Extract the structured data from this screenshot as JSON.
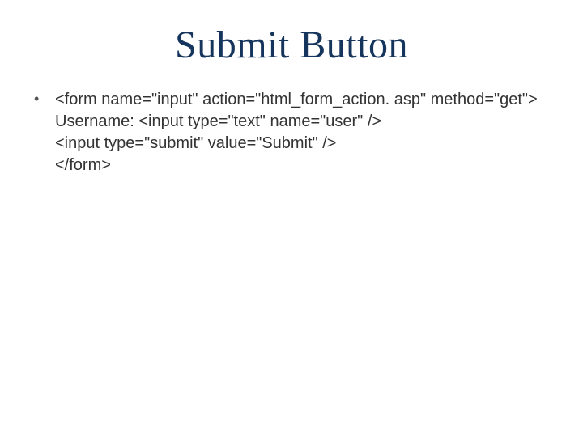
{
  "title": "Submit Button",
  "bullet": {
    "lines": [
      "<form name=\"input\" action=\"html_form_action. asp\" method=\"get\">",
      "Username: <input type=\"text\" name=\"user\" />",
      "<input type=\"submit\" value=\"Submit\" />",
      "</form>"
    ]
  }
}
